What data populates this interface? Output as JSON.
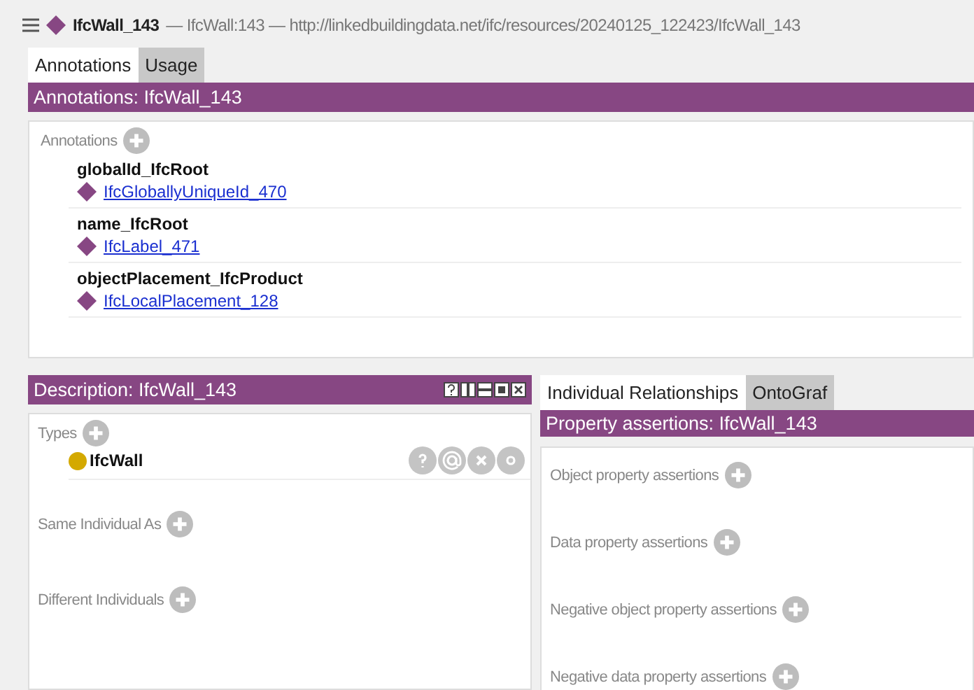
{
  "title_bar": {
    "entity": "IfcWall_143",
    "rest": "— IfcWall:143 — http://linkedbuildingdata.net/ifc/resources/20240125_122423/IfcWall_143"
  },
  "tabs": [
    {
      "label": "Annotations",
      "selected": true
    },
    {
      "label": "Usage",
      "selected": false
    }
  ],
  "annotations_header": "Annotations: IfcWall_143",
  "annotations": {
    "label": "Annotations",
    "items": [
      {
        "property": "globalId_IfcRoot",
        "value": "IfcGloballyUniqueId_470"
      },
      {
        "property": "name_IfcRoot",
        "value": "IfcLabel_471"
      },
      {
        "property": "objectPlacement_IfcProduct",
        "value": "IfcLocalPlacement_128"
      }
    ]
  },
  "description": {
    "header": "Description: IfcWall_143",
    "types_label": "Types",
    "types": [
      {
        "name": "IfcWall",
        "color": "#d4a900"
      }
    ],
    "sections": [
      "Same Individual As",
      "Different Individuals"
    ]
  },
  "right_tabs": [
    {
      "label": "Individual Relationships",
      "selected": true
    },
    {
      "label": "OntoGraf",
      "selected": false
    }
  ],
  "property_header": "Property assertions: IfcWall_143",
  "property_sections": [
    "Object property assertions",
    "Data property assertions",
    "Negative object property assertions",
    "Negative data property assertions"
  ]
}
